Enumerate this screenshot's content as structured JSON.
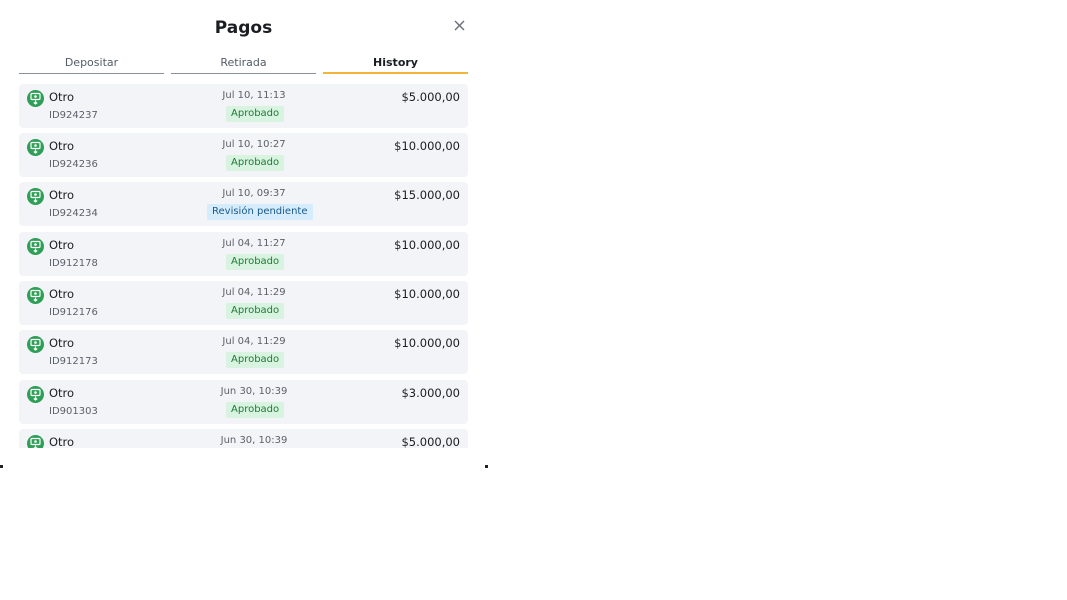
{
  "modal": {
    "title": "Pagos",
    "tabs": [
      "Depositar",
      "Retirada",
      "History"
    ],
    "active_tab": "History"
  },
  "transactions": [
    {
      "method": "Otro",
      "id": "ID924237",
      "date": "Jul 10, 11:13",
      "status": "Aprobado",
      "status_type": "approved",
      "amount": "$5.000,00"
    },
    {
      "method": "Otro",
      "id": "ID924236",
      "date": "Jul 10, 10:27",
      "status": "Aprobado",
      "status_type": "approved",
      "amount": "$10.000,00"
    },
    {
      "method": "Otro",
      "id": "ID924234",
      "date": "Jul 10, 09:37",
      "status": "Revisión pendiente",
      "status_type": "pending",
      "amount": "$15.000,00"
    },
    {
      "method": "Otro",
      "id": "ID912178",
      "date": "Jul 04, 11:27",
      "status": "Aprobado",
      "status_type": "approved",
      "amount": "$10.000,00"
    },
    {
      "method": "Otro",
      "id": "ID912176",
      "date": "Jul 04, 11:29",
      "status": "Aprobado",
      "status_type": "approved",
      "amount": "$10.000,00"
    },
    {
      "method": "Otro",
      "id": "ID912173",
      "date": "Jul 04, 11:29",
      "status": "Aprobado",
      "status_type": "approved",
      "amount": "$10.000,00"
    },
    {
      "method": "Otro",
      "id": "ID901303",
      "date": "Jun 30, 10:39",
      "status": "Aprobado",
      "status_type": "approved",
      "amount": "$3.000,00"
    },
    {
      "method": "Otro",
      "id": "",
      "date": "Jun 30, 10:39",
      "status": "",
      "status_type": "",
      "amount": "$5.000,00"
    }
  ],
  "icons": {
    "close": "close-icon",
    "deposit_method": "deposit-money-icon"
  },
  "colors": {
    "accent_tab": "#f2b53a",
    "icon_green": "#2f9e57",
    "approved_bg": "#d8f3df",
    "pending_bg": "#d4ecfb"
  }
}
